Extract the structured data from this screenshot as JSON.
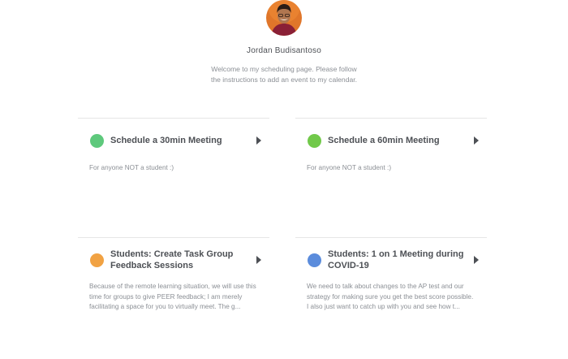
{
  "profile": {
    "name": "Jordan Budisantoso",
    "welcome": "Welcome to my scheduling page. Please follow the instructions to add an event to my calendar."
  },
  "events": [
    {
      "title": "Schedule a 30min Meeting",
      "description": "For anyone NOT a student :)",
      "color": "#5ec97c"
    },
    {
      "title": "Schedule a 60min Meeting",
      "description": "For anyone NOT a student :)",
      "color": "#71c94a"
    },
    {
      "title": "Students: Create Task Group Feedback Sessions",
      "description": "Because of the remote learning situation, we will use this time for groups to give PEER feedback; I am merely facilitating a space for you to virtually meet. The g...",
      "color": "#f1a243"
    },
    {
      "title": "Students: 1 on 1 Meeting during COVID-19",
      "description": "We need to talk about changes to the AP test and our strategy for making sure you get the best score possible. I also just want to catch up with you and see how t...",
      "color": "#5b8cdc"
    }
  ]
}
